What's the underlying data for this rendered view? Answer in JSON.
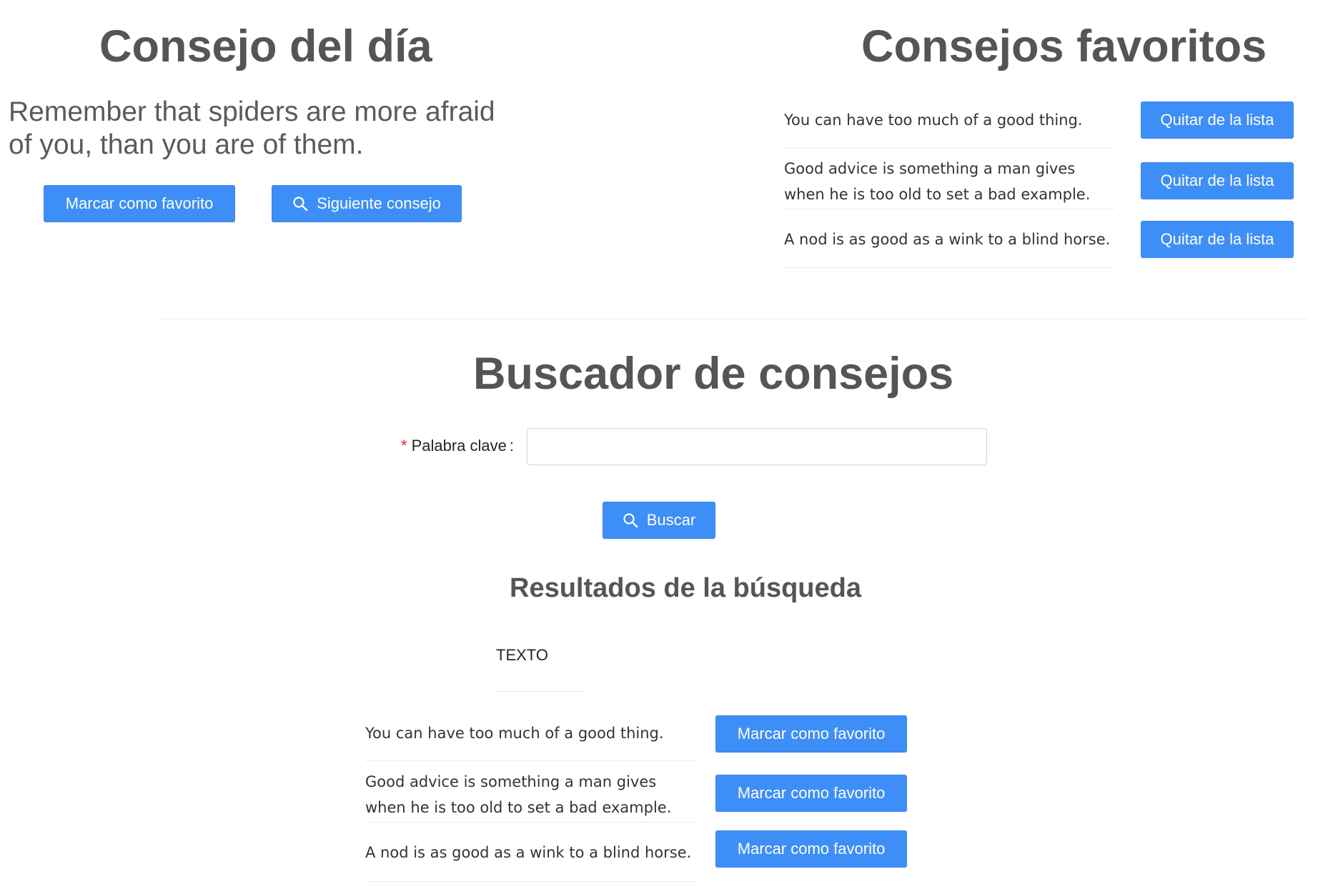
{
  "tip_of_day": {
    "title": "Consejo del día",
    "text": "Remember that spiders are more afraid of you, than you are of them.",
    "favorite_button": "Marcar como favorito",
    "next_button": "Siguiente consejo",
    "next_icon": "search-icon"
  },
  "favorites": {
    "title": "Consejos favoritos",
    "items": [
      {
        "text": "You can have too much of a good thing.",
        "button": "Quitar de la lista"
      },
      {
        "text": "Good advice is something a man gives when he is too old to set a bad example.",
        "button": "Quitar de la lista"
      },
      {
        "text": "A nod is as good as a wink to a blind horse.",
        "button": "Quitar de la lista"
      }
    ]
  },
  "search": {
    "title": "Buscador de consejos",
    "field_label": "Palabra clave",
    "required_mark": "*",
    "colon": ":",
    "input_value": "",
    "button": "Buscar",
    "button_icon": "search-icon"
  },
  "results": {
    "title": "Resultados de la búsqueda",
    "column_header": "TEXTO",
    "items": [
      {
        "text": "You can have too much of a good thing.",
        "button": "Marcar como favorito"
      },
      {
        "text": "Good advice is something a man gives when he is too old to set a bad example.",
        "button": "Marcar como favorito"
      },
      {
        "text": "A nod is as good as a wink to a blind horse.",
        "button": "Marcar como favorito"
      }
    ]
  },
  "colors": {
    "primary": "#3e8ef7",
    "heading": "#555555",
    "required": "#f5222d"
  }
}
